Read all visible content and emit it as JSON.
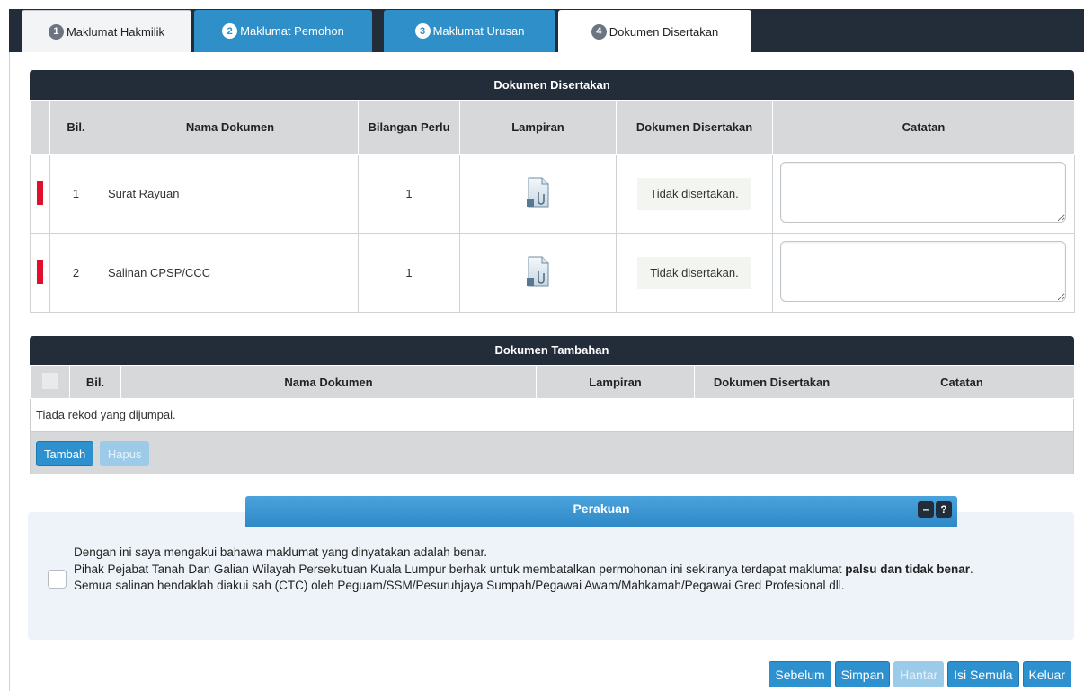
{
  "tabs": [
    {
      "num": "1",
      "label": "Maklumat Hakmilik"
    },
    {
      "num": "2",
      "label": "Maklumat Pemohon"
    },
    {
      "num": "3",
      "label": "Maklumat Urusan"
    },
    {
      "num": "4",
      "label": "Dokumen Disertakan"
    }
  ],
  "docs_table": {
    "title": "Dokumen Disertakan",
    "headers": {
      "bil": "Bil.",
      "nama": "Nama Dokumen",
      "bilangan": "Bilangan Perlu",
      "lampiran": "Lampiran",
      "disertakan": "Dokumen Disertakan",
      "catatan": "Catatan"
    },
    "rows": [
      {
        "bil": "1",
        "nama": "Surat Rayuan",
        "bilangan": "1",
        "status": "Tidak disertakan."
      },
      {
        "bil": "2",
        "nama": "Salinan CPSP/CCC",
        "bilangan": "1",
        "status": "Tidak disertakan."
      }
    ]
  },
  "extra_table": {
    "title": "Dokumen Tambahan",
    "headers": {
      "bil": "Bil.",
      "nama": "Nama Dokumen",
      "lampiran": "Lampiran",
      "disertakan": "Dokumen Disertakan",
      "catatan": "Catatan"
    },
    "empty_text": "Tiada rekod yang dijumpai.",
    "add_label": "Tambah",
    "delete_label": "Hapus"
  },
  "perakuan": {
    "title": "Perakuan",
    "minimize_icon": "minus-icon",
    "help_icon": "question-icon",
    "line1": "Dengan ini saya mengakui bahawa maklumat yang dinyatakan adalah benar.",
    "line2_pre": "Pihak Pejabat Tanah Dan Galian Wilayah Persekutuan Kuala Lumpur berhak untuk membatalkan permohonan ini sekiranya terdapat maklumat ",
    "line2_bold": "palsu dan tidak benar",
    "line2_post": ".",
    "line3": "Semua salinan hendaklah diakui sah (CTC) oleh Peguam/SSM/Pesuruhjaya Sumpah/Pegawai Awam/Mahkamah/Pegawai Gred Profesional dll."
  },
  "actions": {
    "prev": "Sebelum",
    "save": "Simpan",
    "send": "Hantar",
    "reset": "Isi Semula",
    "exit": "Keluar"
  },
  "colors": {
    "header_dark": "#232d3a",
    "accent_blue": "#2f8fc8",
    "required_red": "#e0102a"
  }
}
